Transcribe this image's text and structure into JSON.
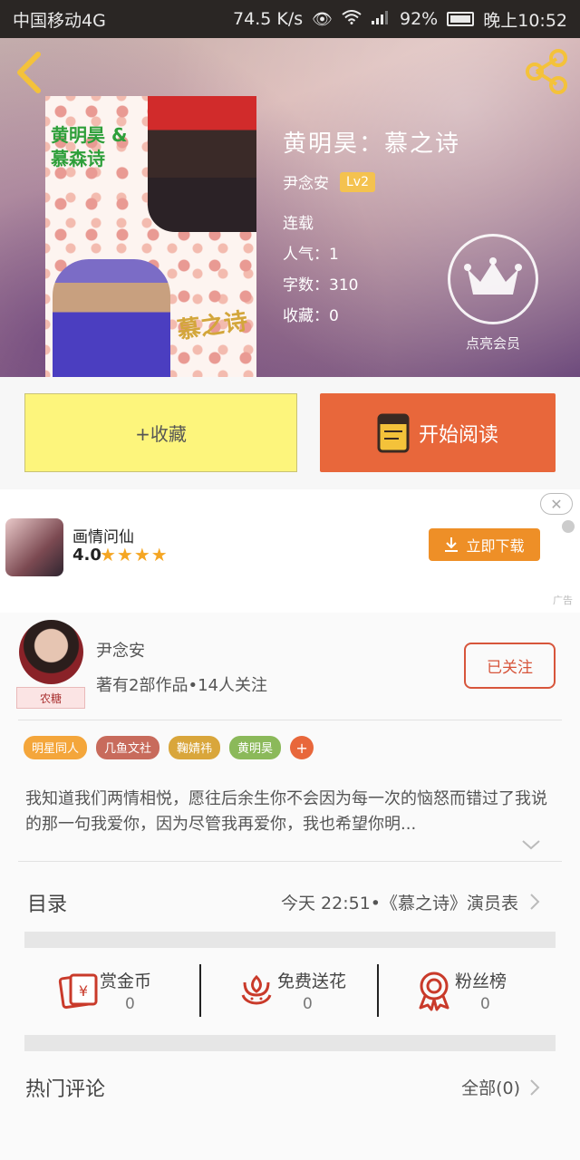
{
  "status_bar": {
    "carrier": "中国移动4G",
    "speed": "74.5 K/s",
    "battery": "92%",
    "time": "晚上10:52"
  },
  "book": {
    "title": "黄明昊：慕之诗",
    "author": "尹念安",
    "level": "Lv2",
    "status": "连载",
    "popularity": "人气：1",
    "word_count": "字数：310",
    "favorites": "收藏：0",
    "vip_label": "点亮会员",
    "cover_text_1": "黄明昊 & 慕森诗",
    "cover_text_2": "慕之诗"
  },
  "actions": {
    "collect_label": "+收藏",
    "read_label": "开始阅读"
  },
  "ad": {
    "app_name": "画情问仙",
    "rating": "4.0",
    "stars": "★★★★",
    "download_label": "立即下载",
    "ad_tag": "广告",
    "close": "✕"
  },
  "author": {
    "name": "尹念安",
    "stats": "著有2部作品•14人关注",
    "avatar_tag": "农糖",
    "follow_label": "已关注"
  },
  "tags": [
    {
      "label": "明星同人",
      "color": "#f4a63b"
    },
    {
      "label": "几鱼文社",
      "color": "#c86b5c"
    },
    {
      "label": "鞠婧祎",
      "color": "#d9a63b"
    },
    {
      "label": "黄明昊",
      "color": "#8bb95a"
    }
  ],
  "tag_plus": "+",
  "description": "我知道我们两情相悦，愿往后余生你不会因为每一次的恼怒而错过了我说的那一句我爱你，因为尽管我再爱你，我也希望你明...",
  "toc": {
    "label": "目录",
    "latest": "今天 22:51•《慕之诗》演员表"
  },
  "stats": [
    {
      "label": "赏金币",
      "value": "0",
      "icon": "reward-coin-icon"
    },
    {
      "label": "免费送花",
      "value": "0",
      "icon": "flower-icon"
    },
    {
      "label": "粉丝榜",
      "value": "0",
      "icon": "badge-ribbon-icon"
    }
  ],
  "comments": {
    "label": "热门评论",
    "all": "全部(0)"
  },
  "colors": {
    "accent": "#e8673b",
    "collect_bg": "#fdf57c",
    "follow": "#d7553b",
    "icon_yellow": "#f4c23a"
  }
}
